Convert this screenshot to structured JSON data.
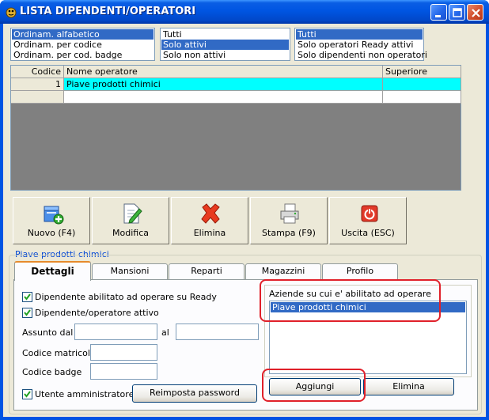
{
  "window": {
    "title": "LISTA DIPENDENTI/OPERATORI"
  },
  "sort_list": {
    "items": [
      "Ordinam. alfabetico",
      "Ordinam. per codice",
      "Ordinam. per cod. badge"
    ],
    "selected": 0
  },
  "active_list": {
    "items": [
      "Tutti",
      "Solo attivi",
      "Solo non attivi"
    ],
    "selected": 1
  },
  "type_list": {
    "items": [
      "Tutti",
      "Solo operatori Ready attivi",
      "Solo dipendenti non operatori"
    ],
    "selected": 0
  },
  "grid": {
    "headers": {
      "code": "Codice",
      "name": "Nome operatore",
      "superior": "Superiore"
    },
    "rows": [
      {
        "code": "1",
        "name": "Piave prodotti chimici",
        "superior": ""
      }
    ]
  },
  "toolbar": {
    "new_label": "Nuovo (F4)",
    "edit_label": "Modifica",
    "delete_label": "Elimina",
    "print_label": "Stampa (F9)",
    "exit_label": "Uscita (ESC)"
  },
  "detail": {
    "group_title": "Piave prodotti chimici"
  },
  "tabs": [
    "Dettagli",
    "Mansioni",
    "Reparti",
    "Magazzini",
    "Profilo"
  ],
  "dettagli": {
    "enabled_ready_label": "Dipendente abilitato ad operare su Ready",
    "enabled_ready_checked": true,
    "active_label": "Dipendente/operatore attivo",
    "active_checked": true,
    "hired_from_label": "Assunto dal",
    "hired_from_value": "",
    "hired_to_label": "al",
    "hired_to_value": "",
    "matricola_label": "Codice matricola",
    "matricola_value": "",
    "badge_label": "Codice badge",
    "badge_value": "",
    "admin_label": "Utente amministratore",
    "admin_checked": true,
    "reset_password_label": "Reimposta password",
    "companies_label": "Aziende su cui e' abilitato ad operare",
    "companies": [
      "Piave prodotti chimici"
    ],
    "add_label": "Aggiungi",
    "remove_label": "Elimina"
  },
  "colors": {
    "selection": "#316ac5",
    "grid_row_selected": "#00ffff",
    "highlight": "#e0202a",
    "titlebar": "#0054e3",
    "tab_accent": "#e68b2c"
  },
  "icons": {
    "title": "app-icon",
    "new": "new-document-icon",
    "edit": "edit-icon",
    "delete": "delete-x-icon",
    "print": "printer-icon",
    "exit": "power-icon"
  }
}
